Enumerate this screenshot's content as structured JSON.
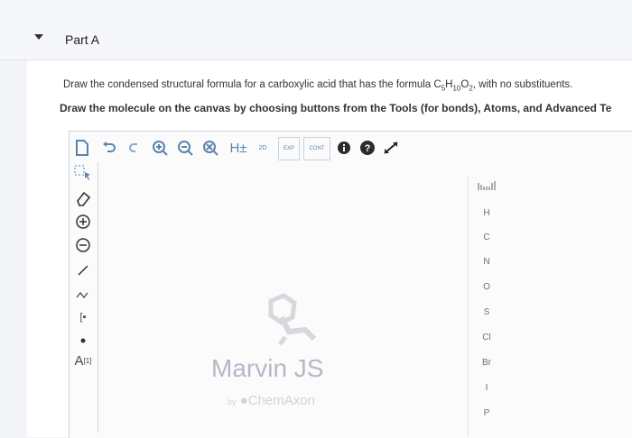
{
  "part": {
    "title": "Part A"
  },
  "instructions": {
    "line1_pre": "Draw the condensed structural formula for a carboxylic acid that has the formula ",
    "formula": {
      "c": "C",
      "c_sub": "5",
      "h": "H",
      "h_sub": "10",
      "o": "O",
      "o_sub": "2"
    },
    "line1_post": ", with no substituents.",
    "line2": "Draw the molecule on the canvas by choosing buttons from the Tools (for bonds), Atoms, and Advanced Te"
  },
  "top_toolbar": {
    "h_button_label": "H±",
    "twoD_label": "2D",
    "exp_label": "EXP",
    "cont_label": "CONT"
  },
  "left_toolbar": {
    "atom_label": "A",
    "atom_sup": "[1]",
    "charge_label": "[▪"
  },
  "atoms": [
    "H",
    "C",
    "N",
    "O",
    "S",
    "Cl",
    "Br",
    "I",
    "P"
  ],
  "watermark": {
    "name": "Marvin JS",
    "by": "by",
    "company": "ChemAxon"
  },
  "colors": {
    "accent": "#5a84ac",
    "watermark": "#b6b9c5"
  }
}
